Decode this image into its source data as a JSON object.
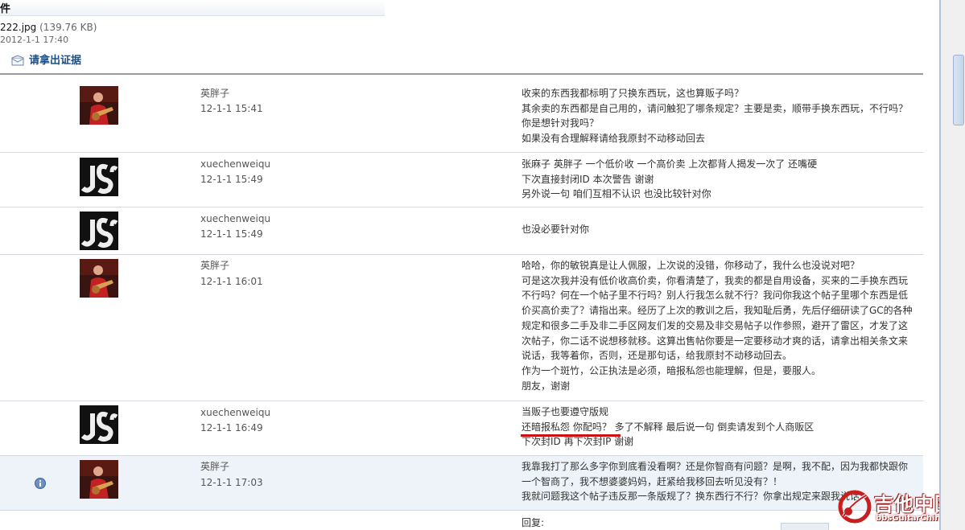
{
  "header": {
    "title": "件"
  },
  "attachment": {
    "name": "222.jpg",
    "size": "(139.76 KB)",
    "date": "2012-1-1 17:40"
  },
  "section": {
    "title": "请拿出证据",
    "icon": "envelope-icon"
  },
  "posts": [
    {
      "user": "英胖子",
      "time": "12-1-1 15:41",
      "avatar": "guitarist-avatar",
      "lines": [
        "收来的东西我都标明了只换东西玩，这也算贩子吗？",
        "其余卖的东西都是自己用的，请问触犯了哪条规定？主要是卖，顺带手换东西玩，不行吗？",
        "你是想针对我吗？",
        "如果没有合理解释请给我原封不动移动回去"
      ]
    },
    {
      "user": "xuechenweiqu",
      "time": "12-1-1 15:49",
      "avatar": "logo-avatar",
      "lines": [
        "张麻子  英胖子  一个低价收  一个高价卖  上次都背人揭发一次了  还嘴硬",
        "下次直接封闭ID  本次警告  谢谢",
        "另外说一句  咱们互相不认识  也没比较针对你"
      ]
    },
    {
      "user": "xuechenweiqu",
      "time": "12-1-1 15:49",
      "avatar": "logo-avatar",
      "lines": [
        "也没必要针对你"
      ]
    },
    {
      "user": "英胖子",
      "time": "12-1-1 16:01",
      "avatar": "guitarist-avatar",
      "lines": [
        "哈哈，你的敏锐真是让人佩服，上次说的没错，你移动了，我什么也没说对吧？",
        "可是这次我并没有低价收高价卖，你看清楚了，我卖的都是自用设备，买来的二手换东西玩",
        "不行吗？何在一个帖子里不行吗？别人行我怎么就不行？我问你我这个帖子里哪个东西是低",
        "价买高价卖了？请指出来。经历了上次的教训之后，我知耻后勇，先后仔细研读了GC的各种",
        "规定和很多二手及非二手区网友们发的交易及非交易帖子以作参照，避开了雷区，才发了这",
        "次帖子，你二话不说想移就移。这算出售帖你要是一定要移动才爽的话，请拿出相关条文来",
        "说话，我等着你，否则，还是那句话，给我原封不动移动回去。",
        "作为一个斑竹，公正执法是必须，暗报私怨也能理解，但是，要服人。",
        "朋友，谢谢"
      ]
    },
    {
      "user": "xuechenweiqu",
      "time": "12-1-1 16:49",
      "avatar": "logo-avatar",
      "lines": [
        "当贩子也要遵守版规",
        "还暗报私怨  你配吗？  多了不解释  最后说一句  倒卖请发到个人商贩区",
        "下次封ID  再下次封IP 谢谢"
      ]
    },
    {
      "user": "英胖子",
      "time": "12-1-1 17:03",
      "avatar": "guitarist-avatar",
      "lines": [
        "我靠我打了那么多字你到底看没看啊？还是你智商有问题？是啊，我不配，因为我都快跟你",
        "一个智商了，我不想婆婆妈妈，赶紧给我移回去听见没有？！",
        "我就问题我这个帖子违反那一条版规了？换东西行不行？你拿出规定来跟我说话"
      ]
    }
  ],
  "reply": {
    "label": "回复:"
  },
  "watermark": {
    "main": "吉他中国",
    "url": "bbsGuitarChina.com"
  },
  "colors": {
    "accent": "#1c4e86",
    "underline": "#cc1111",
    "highlight_row": "#eef3f9"
  }
}
